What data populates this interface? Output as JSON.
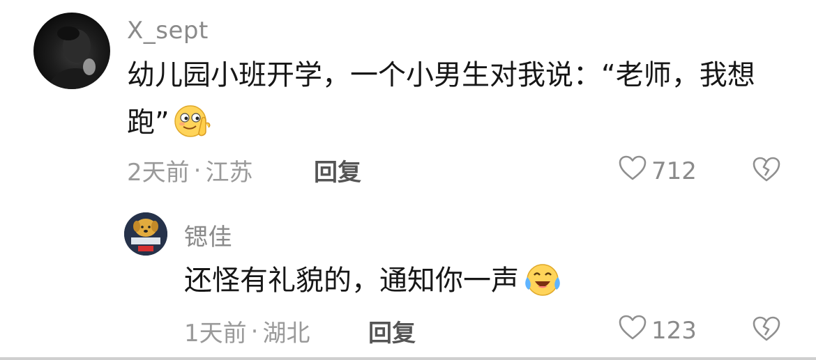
{
  "comments": [
    {
      "username": "X_sept",
      "avatar": "dark-photo-avatar",
      "content": "幼儿园小班开学，一个小男生对我说：“老师，我想跑”",
      "emoji": "smirk-hand-emoji",
      "time": "2天前",
      "location": "江苏",
      "reply_label": "回复",
      "likes": "712"
    },
    {
      "username": "锶佳",
      "avatar": "cartoon-dog-avatar",
      "content": "还怪有礼貌的，通知你一声",
      "emoji": "crying-laughing-emoji",
      "time": "1天前",
      "location": "湖北",
      "reply_label": "回复",
      "likes": "123"
    }
  ],
  "meta_separator": "·",
  "icons": {
    "like": "heart-outline-icon",
    "dislike": "broken-heart-icon"
  },
  "colors": {
    "username": "#8a8a8a",
    "content": "#161616",
    "meta": "#9a9a9a",
    "reply": "#555555",
    "emoji_face": "#ffd45a"
  }
}
